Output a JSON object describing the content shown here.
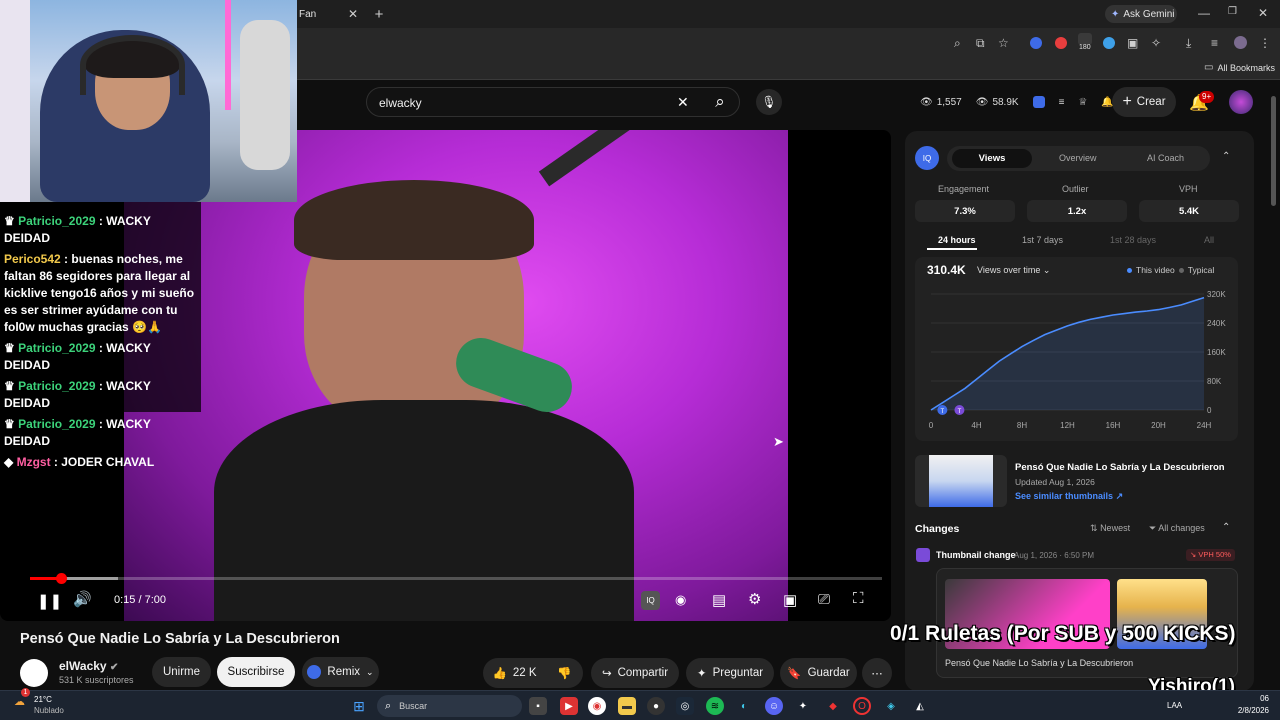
{
  "browser": {
    "tab_label": "Fan",
    "ask_gemini": "Ask Gemini",
    "all_bookmarks": "All Bookmarks",
    "ext_badge": "180"
  },
  "yt_header": {
    "search_value": "elwacky",
    "views_count": "1,557",
    "views_total": "58.9K",
    "create_label": "Crear",
    "notif_badge": "9+"
  },
  "chat": [
    {
      "user": "Patricio_2029",
      "sep": " : ",
      "msg": "WACKY DEIDAD",
      "color": "green"
    },
    {
      "user": "Perico542",
      "sep": " : ",
      "msg": "buenas noches, me faltan 86 segidores para llegar al kicklive tengo16 años y mi sueño es ser strimer ayúdame con tu fol0w muchas gracias 🥺🙏",
      "color": "yellow"
    },
    {
      "user": "Patricio_2029",
      "sep": " : ",
      "msg": "WACKY DEIDAD",
      "color": "green"
    },
    {
      "user": "Patricio_2029",
      "sep": " : ",
      "msg": "WACKY DEIDAD",
      "color": "green"
    },
    {
      "user": "Patricio_2029",
      "sep": " : ",
      "msg": "WACKY DEIDAD",
      "color": "green"
    },
    {
      "user": "Mzgst",
      "sep": " : ",
      "msg": "JODER CHAVAL",
      "color": "pink"
    }
  ],
  "player": {
    "time": "0:15 / 7:00",
    "progress_fraction": 0.036
  },
  "video": {
    "title": "Pensó Que Nadie Lo Sabría y La Descubrieron",
    "channel": "elWacky",
    "subscribers": "531 K suscriptores",
    "join": "Unirme",
    "subscribe": "Suscribirse",
    "remix": "Remix",
    "likes": "22 K",
    "share": "Compartir",
    "ask": "Preguntar",
    "save": "Guardar"
  },
  "panel": {
    "tabs": [
      "Views",
      "Overview",
      "AI Coach"
    ],
    "active_tab": "Views",
    "stats": [
      {
        "label": "Engagement",
        "value": "7.3%"
      },
      {
        "label": "Outlier",
        "value": "1.2x"
      },
      {
        "label": "VPH",
        "value": "5.4K"
      }
    ],
    "ranges": [
      "24 hours",
      "1st 7 days",
      "1st 28 days",
      "All"
    ],
    "active_range": "24 hours",
    "total": "310.4K",
    "mode": "Views over time",
    "legend_this": "This video",
    "legend_typical": "Typical",
    "thumb_title": "Pensó Que Nadie Lo Sabría y La Descubrieron",
    "thumb_updated": "Updated Aug 1, 2026",
    "thumb_link": "See similar thumbnails",
    "changes_title": "Changes",
    "sort_label": "Newest",
    "filter_label": "All changes",
    "change_title": "Thumbnail change",
    "change_date": "Aug 1, 2026 · 6:50 PM",
    "change_badge": "VPH 50%",
    "card_title": "Pensó Que Nadie Lo Sabría y La Descubrieron"
  },
  "chart_data": {
    "type": "area",
    "x_ticks": [
      "0",
      "4H",
      "8H",
      "12H",
      "16H",
      "20H",
      "24H"
    ],
    "y_ticks": [
      "0",
      "80K",
      "160K",
      "240K",
      "320K"
    ],
    "xlim": [
      0,
      24
    ],
    "ylim": [
      0,
      320000
    ],
    "series": [
      {
        "name": "This video",
        "x": [
          0,
          1,
          2,
          3,
          4,
          5,
          6,
          7,
          8,
          9,
          10,
          11,
          12,
          13,
          14,
          15,
          16,
          17,
          18,
          19,
          20,
          21,
          22,
          23,
          24
        ],
        "y": [
          0,
          20000,
          40000,
          60000,
          85000,
          110000,
          135000,
          155000,
          175000,
          192000,
          208000,
          220000,
          232000,
          242000,
          250000,
          256000,
          262000,
          266000,
          270000,
          273000,
          277000,
          283000,
          290000,
          300000,
          310000
        ]
      }
    ],
    "markers": [
      "T",
      "T"
    ],
    "legend": "top-right",
    "grid": true
  },
  "overlay": {
    "ruletas": "0/1 Ruletas (Por SUB y 500 KICKS)",
    "name": "Yishiro(1)"
  },
  "taskbar": {
    "weather_temp": "21°C",
    "weather_desc": "Nublado",
    "search_placeholder": "Buscar",
    "lang": "LAA",
    "time": "06",
    "date": "2/8/2026",
    "notif_count": "1"
  }
}
